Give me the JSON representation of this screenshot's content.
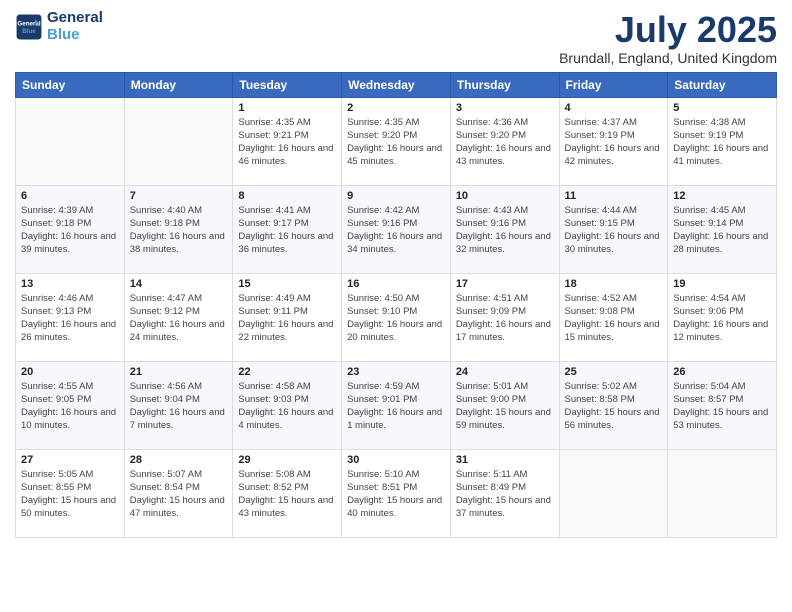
{
  "header": {
    "logo_line1": "General",
    "logo_line2": "Blue",
    "title": "July 2025",
    "subtitle": "Brundall, England, United Kingdom"
  },
  "calendar": {
    "weekdays": [
      "Sunday",
      "Monday",
      "Tuesday",
      "Wednesday",
      "Thursday",
      "Friday",
      "Saturday"
    ],
    "weeks": [
      [
        {
          "day": "",
          "info": ""
        },
        {
          "day": "",
          "info": ""
        },
        {
          "day": "1",
          "info": "Sunrise: 4:35 AM\nSunset: 9:21 PM\nDaylight: 16 hours and 46 minutes."
        },
        {
          "day": "2",
          "info": "Sunrise: 4:35 AM\nSunset: 9:20 PM\nDaylight: 16 hours and 45 minutes."
        },
        {
          "day": "3",
          "info": "Sunrise: 4:36 AM\nSunset: 9:20 PM\nDaylight: 16 hours and 43 minutes."
        },
        {
          "day": "4",
          "info": "Sunrise: 4:37 AM\nSunset: 9:19 PM\nDaylight: 16 hours and 42 minutes."
        },
        {
          "day": "5",
          "info": "Sunrise: 4:38 AM\nSunset: 9:19 PM\nDaylight: 16 hours and 41 minutes."
        }
      ],
      [
        {
          "day": "6",
          "info": "Sunrise: 4:39 AM\nSunset: 9:18 PM\nDaylight: 16 hours and 39 minutes."
        },
        {
          "day": "7",
          "info": "Sunrise: 4:40 AM\nSunset: 9:18 PM\nDaylight: 16 hours and 38 minutes."
        },
        {
          "day": "8",
          "info": "Sunrise: 4:41 AM\nSunset: 9:17 PM\nDaylight: 16 hours and 36 minutes."
        },
        {
          "day": "9",
          "info": "Sunrise: 4:42 AM\nSunset: 9:16 PM\nDaylight: 16 hours and 34 minutes."
        },
        {
          "day": "10",
          "info": "Sunrise: 4:43 AM\nSunset: 9:16 PM\nDaylight: 16 hours and 32 minutes."
        },
        {
          "day": "11",
          "info": "Sunrise: 4:44 AM\nSunset: 9:15 PM\nDaylight: 16 hours and 30 minutes."
        },
        {
          "day": "12",
          "info": "Sunrise: 4:45 AM\nSunset: 9:14 PM\nDaylight: 16 hours and 28 minutes."
        }
      ],
      [
        {
          "day": "13",
          "info": "Sunrise: 4:46 AM\nSunset: 9:13 PM\nDaylight: 16 hours and 26 minutes."
        },
        {
          "day": "14",
          "info": "Sunrise: 4:47 AM\nSunset: 9:12 PM\nDaylight: 16 hours and 24 minutes."
        },
        {
          "day": "15",
          "info": "Sunrise: 4:49 AM\nSunset: 9:11 PM\nDaylight: 16 hours and 22 minutes."
        },
        {
          "day": "16",
          "info": "Sunrise: 4:50 AM\nSunset: 9:10 PM\nDaylight: 16 hours and 20 minutes."
        },
        {
          "day": "17",
          "info": "Sunrise: 4:51 AM\nSunset: 9:09 PM\nDaylight: 16 hours and 17 minutes."
        },
        {
          "day": "18",
          "info": "Sunrise: 4:52 AM\nSunset: 9:08 PM\nDaylight: 16 hours and 15 minutes."
        },
        {
          "day": "19",
          "info": "Sunrise: 4:54 AM\nSunset: 9:06 PM\nDaylight: 16 hours and 12 minutes."
        }
      ],
      [
        {
          "day": "20",
          "info": "Sunrise: 4:55 AM\nSunset: 9:05 PM\nDaylight: 16 hours and 10 minutes."
        },
        {
          "day": "21",
          "info": "Sunrise: 4:56 AM\nSunset: 9:04 PM\nDaylight: 16 hours and 7 minutes."
        },
        {
          "day": "22",
          "info": "Sunrise: 4:58 AM\nSunset: 9:03 PM\nDaylight: 16 hours and 4 minutes."
        },
        {
          "day": "23",
          "info": "Sunrise: 4:59 AM\nSunset: 9:01 PM\nDaylight: 16 hours and 1 minute."
        },
        {
          "day": "24",
          "info": "Sunrise: 5:01 AM\nSunset: 9:00 PM\nDaylight: 15 hours and 59 minutes."
        },
        {
          "day": "25",
          "info": "Sunrise: 5:02 AM\nSunset: 8:58 PM\nDaylight: 15 hours and 56 minutes."
        },
        {
          "day": "26",
          "info": "Sunrise: 5:04 AM\nSunset: 8:57 PM\nDaylight: 15 hours and 53 minutes."
        }
      ],
      [
        {
          "day": "27",
          "info": "Sunrise: 5:05 AM\nSunset: 8:55 PM\nDaylight: 15 hours and 50 minutes."
        },
        {
          "day": "28",
          "info": "Sunrise: 5:07 AM\nSunset: 8:54 PM\nDaylight: 15 hours and 47 minutes."
        },
        {
          "day": "29",
          "info": "Sunrise: 5:08 AM\nSunset: 8:52 PM\nDaylight: 15 hours and 43 minutes."
        },
        {
          "day": "30",
          "info": "Sunrise: 5:10 AM\nSunset: 8:51 PM\nDaylight: 15 hours and 40 minutes."
        },
        {
          "day": "31",
          "info": "Sunrise: 5:11 AM\nSunset: 8:49 PM\nDaylight: 15 hours and 37 minutes."
        },
        {
          "day": "",
          "info": ""
        },
        {
          "day": "",
          "info": ""
        }
      ]
    ]
  }
}
